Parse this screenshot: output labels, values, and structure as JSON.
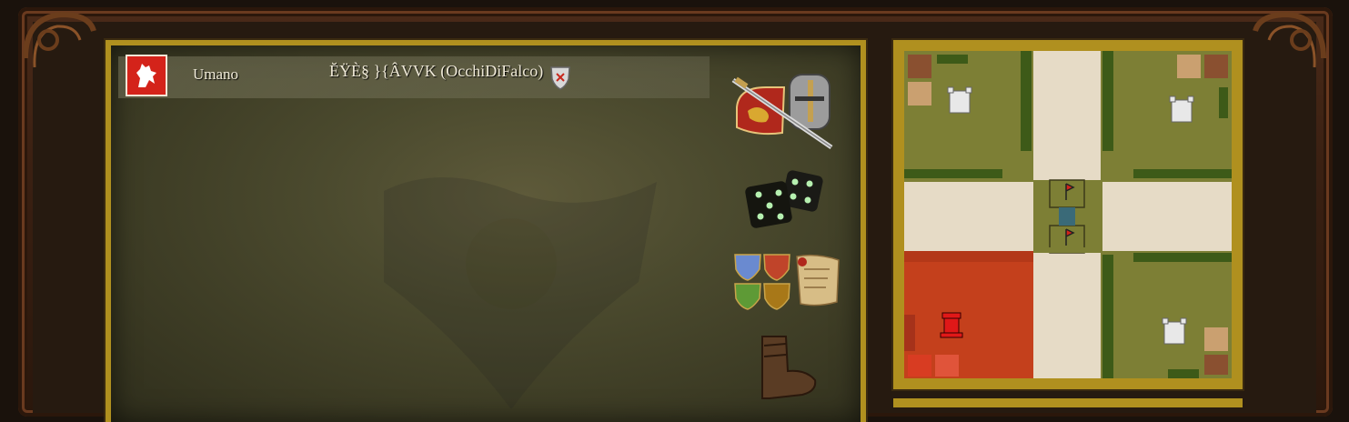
{
  "lobby": {
    "player": {
      "race": "Umano",
      "name": "ĔŸÈ§ }{ÂVVK (OcchiDiFalco)",
      "emblem_color": "#d4231a"
    },
    "side_buttons": [
      {
        "name": "battle-settings-icon"
      },
      {
        "name": "dice-icon"
      },
      {
        "name": "factions-icon"
      },
      {
        "name": "leave-boot-icon"
      }
    ]
  },
  "minimap": {
    "terrain_color": "#7d7f35",
    "road_color": "#e6dbc6",
    "player_territory_color": "#c4401c",
    "players": [
      {
        "position": "bottom-left",
        "color": "#d4231a",
        "occupied": true
      },
      {
        "position": "top-left",
        "color": "#cccccc",
        "occupied": false
      },
      {
        "position": "top-right",
        "color": "#cccccc",
        "occupied": false
      },
      {
        "position": "bottom-right",
        "color": "#cccccc",
        "occupied": false
      }
    ]
  }
}
